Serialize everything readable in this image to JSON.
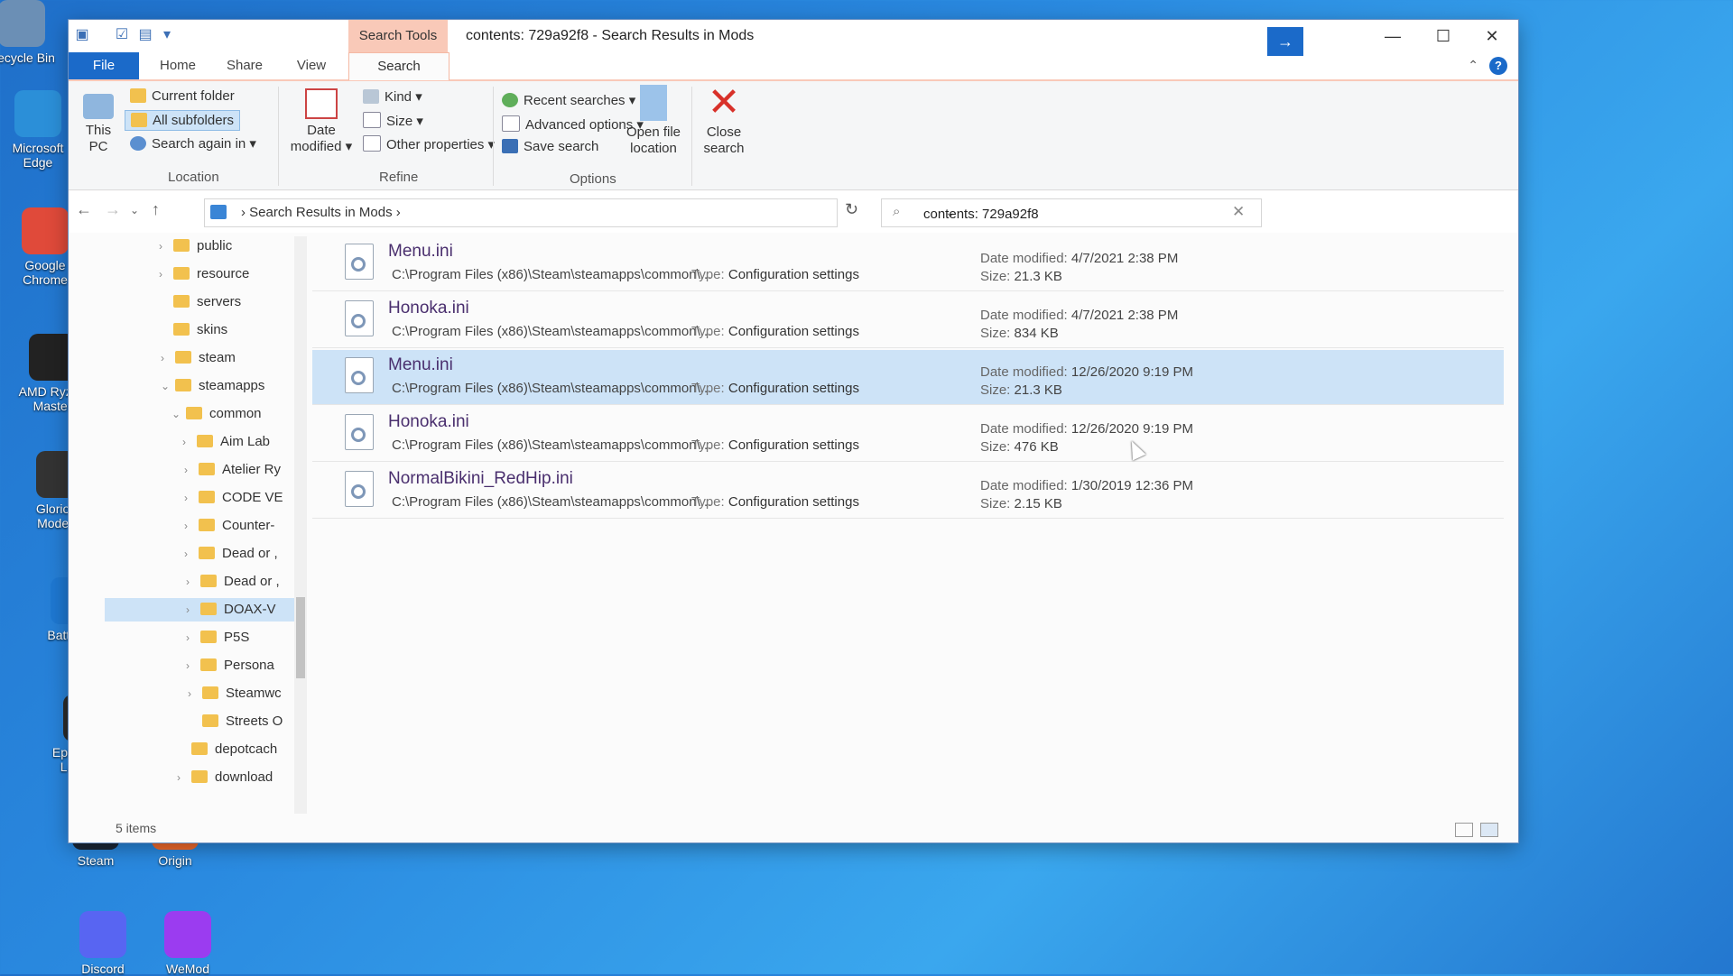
{
  "desktop": {
    "icons": [
      {
        "label": "Recycle Bin",
        "color": "#6b8fb5"
      },
      {
        "label": "Microsoft Edge",
        "color": "#2b8fd8"
      },
      {
        "label": "Google Chrome",
        "color": "#e04a3a"
      },
      {
        "label": "AMD Ryzen Master",
        "color": "#222222"
      },
      {
        "label": "Glorious Model...",
        "color": "#333333"
      },
      {
        "label": "Battle.net",
        "color": "#1e78d2"
      },
      {
        "label": "Epic Games Launcher",
        "color": "#2b2b2b"
      },
      {
        "label": "Steam",
        "color": "#1b2838"
      },
      {
        "label": "Origin",
        "color": "#f56c2d"
      },
      {
        "label": "Discord",
        "color": "#5865f2"
      },
      {
        "label": "WeMod",
        "color": "#9b3cf0"
      }
    ]
  },
  "window": {
    "title": "contents: 729a92f8 - Search Results in Mods",
    "context_tab": "Search Tools",
    "controls": {
      "minimize": "—",
      "maximize": "☐",
      "close": "✕"
    }
  },
  "tabs": {
    "file": "File",
    "home": "Home",
    "share": "Share",
    "view": "View",
    "search": "Search"
  },
  "ribbon": {
    "location": {
      "this_pc": "This PC",
      "current_folder": "Current folder",
      "all_subfolders": "All subfolders",
      "search_again": "Search again in",
      "group": "Location"
    },
    "refine": {
      "date_modified": "Date modified",
      "kind": "Kind",
      "size": "Size",
      "other_properties": "Other properties",
      "group": "Refine"
    },
    "options": {
      "recent_searches": "Recent searches",
      "advanced_options": "Advanced options",
      "save_search": "Save search",
      "open_file_location": "Open file location",
      "close_search": "Close search",
      "group": "Options"
    }
  },
  "address": {
    "crumb": "Search Results in Mods"
  },
  "search": {
    "value": "contents: 729a92f8"
  },
  "tree": [
    {
      "label": "public",
      "level": 1,
      "chev": "›"
    },
    {
      "label": "resource",
      "level": 1,
      "chev": "›"
    },
    {
      "label": "servers",
      "level": 1,
      "chev": ""
    },
    {
      "label": "skins",
      "level": 1,
      "chev": ""
    },
    {
      "label": "steam",
      "level": 1,
      "chev": "›"
    },
    {
      "label": "steamapps",
      "level": 1,
      "chev": "⌄"
    },
    {
      "label": "common",
      "level": 2,
      "chev": "⌄"
    },
    {
      "label": "Aim Lab",
      "level": 3,
      "chev": "›"
    },
    {
      "label": "Atelier Ry",
      "level": 3,
      "chev": "›"
    },
    {
      "label": "CODE VE",
      "level": 3,
      "chev": "›"
    },
    {
      "label": "Counter-",
      "level": 3,
      "chev": "›"
    },
    {
      "label": "Dead or ,",
      "level": 3,
      "chev": "›"
    },
    {
      "label": "Dead or ,",
      "level": 3,
      "chev": "›"
    },
    {
      "label": "DOAX-V",
      "level": 3,
      "chev": "›",
      "selected": true
    },
    {
      "label": "P5S",
      "level": 3,
      "chev": "›"
    },
    {
      "label": "Persona",
      "level": 3,
      "chev": "›"
    },
    {
      "label": "Steamwc",
      "level": 3,
      "chev": "›"
    },
    {
      "label": "Streets O",
      "level": 3,
      "chev": ""
    },
    {
      "label": "depotcach",
      "level": 2,
      "chev": ""
    },
    {
      "label": "download",
      "level": 2,
      "chev": "›"
    }
  ],
  "results": {
    "type_label": "Type:",
    "date_label": "Date modified:",
    "size_label": "Size:",
    "items": [
      {
        "name": "Menu.ini",
        "path": "C:\\Program Files (x86)\\Steam\\steamapps\\common\\...",
        "type": "Configuration settings",
        "date": "4/7/2021 2:38 PM",
        "size": "21.3 KB",
        "selected": false
      },
      {
        "name": "Honoka.ini",
        "path": "C:\\Program Files (x86)\\Steam\\steamapps\\common\\...",
        "type": "Configuration settings",
        "date": "4/7/2021 2:38 PM",
        "size": "834 KB",
        "selected": false
      },
      {
        "name": "Menu.ini",
        "path": "C:\\Program Files (x86)\\Steam\\steamapps\\common\\...",
        "type": "Configuration settings",
        "date": "12/26/2020 9:19 PM",
        "size": "21.3 KB",
        "selected": true
      },
      {
        "name": "Honoka.ini",
        "path": "C:\\Program Files (x86)\\Steam\\steamapps\\common\\...",
        "type": "Configuration settings",
        "date": "12/26/2020 9:19 PM",
        "size": "476 KB",
        "selected": false
      },
      {
        "name": "NormalBikini_RedHip.ini",
        "path": "C:\\Program Files (x86)\\Steam\\steamapps\\common\\...",
        "type": "Configuration settings",
        "date": "1/30/2019 12:36 PM",
        "size": "2.15 KB",
        "selected": false
      }
    ]
  },
  "status": {
    "count": "5 items"
  }
}
